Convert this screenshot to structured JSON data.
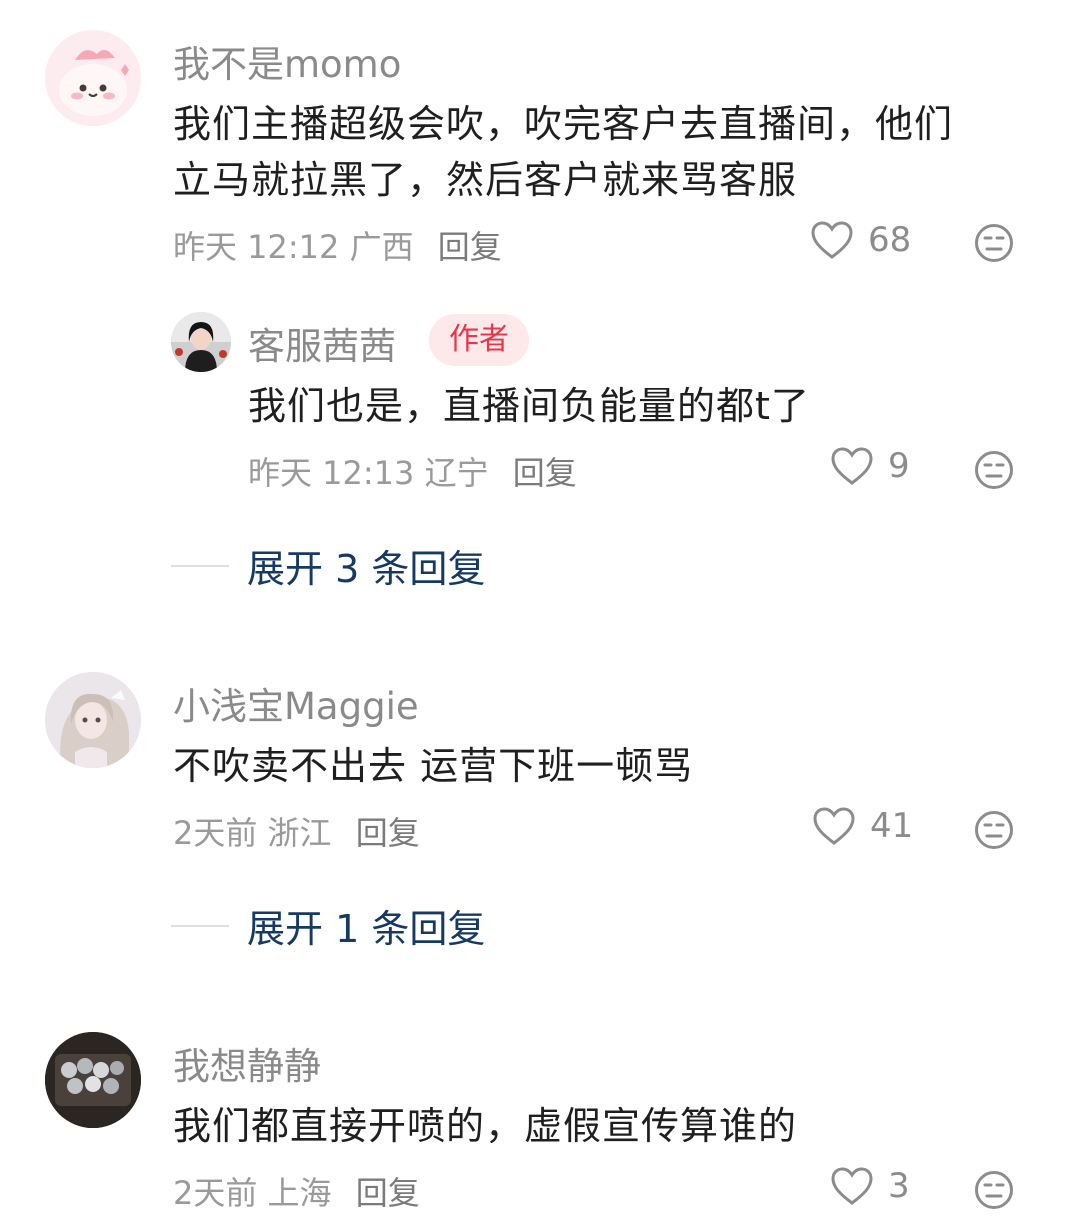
{
  "comments": [
    {
      "user": "我不是momo",
      "lines": [
        "我们主播超级会吹，吹完客户去直播间，他们",
        "立马就拉黑了，然后客户就来骂客服"
      ],
      "time": "昨天 12:12",
      "location": "广西",
      "reply_label": "回复",
      "likes": "68",
      "reply": {
        "user": "客服茜茜",
        "badge": "作者",
        "text": "我们也是，直播间负能量的都t了",
        "time": "昨天 12:13",
        "location": "辽宁",
        "reply_label": "回复",
        "likes": "9"
      },
      "expand_label": "展开 3 条回复"
    },
    {
      "user": "小浅宝Maggie",
      "lines": [
        "不吹卖不出去 运营下班一顿骂"
      ],
      "time": "2天前",
      "location": "浙江",
      "reply_label": "回复",
      "likes": "41",
      "expand_label": "展开 1 条回复"
    },
    {
      "user": "我想静静",
      "lines": [
        "我们都直接开喷的，虚假宣传算谁的"
      ],
      "time": "2天前",
      "location": "上海",
      "reply_label": "回复",
      "likes": "3"
    }
  ],
  "colors": {
    "username": "#8a8a8a",
    "text": "#1f1f1f",
    "meta": "#9a9a9a",
    "expand": "#163a63",
    "author_badge_bg": "#fde8ea",
    "author_badge_text": "#e8364b"
  },
  "icons": {
    "like": "heart-outline-icon",
    "dislike": "meh-face-icon"
  }
}
